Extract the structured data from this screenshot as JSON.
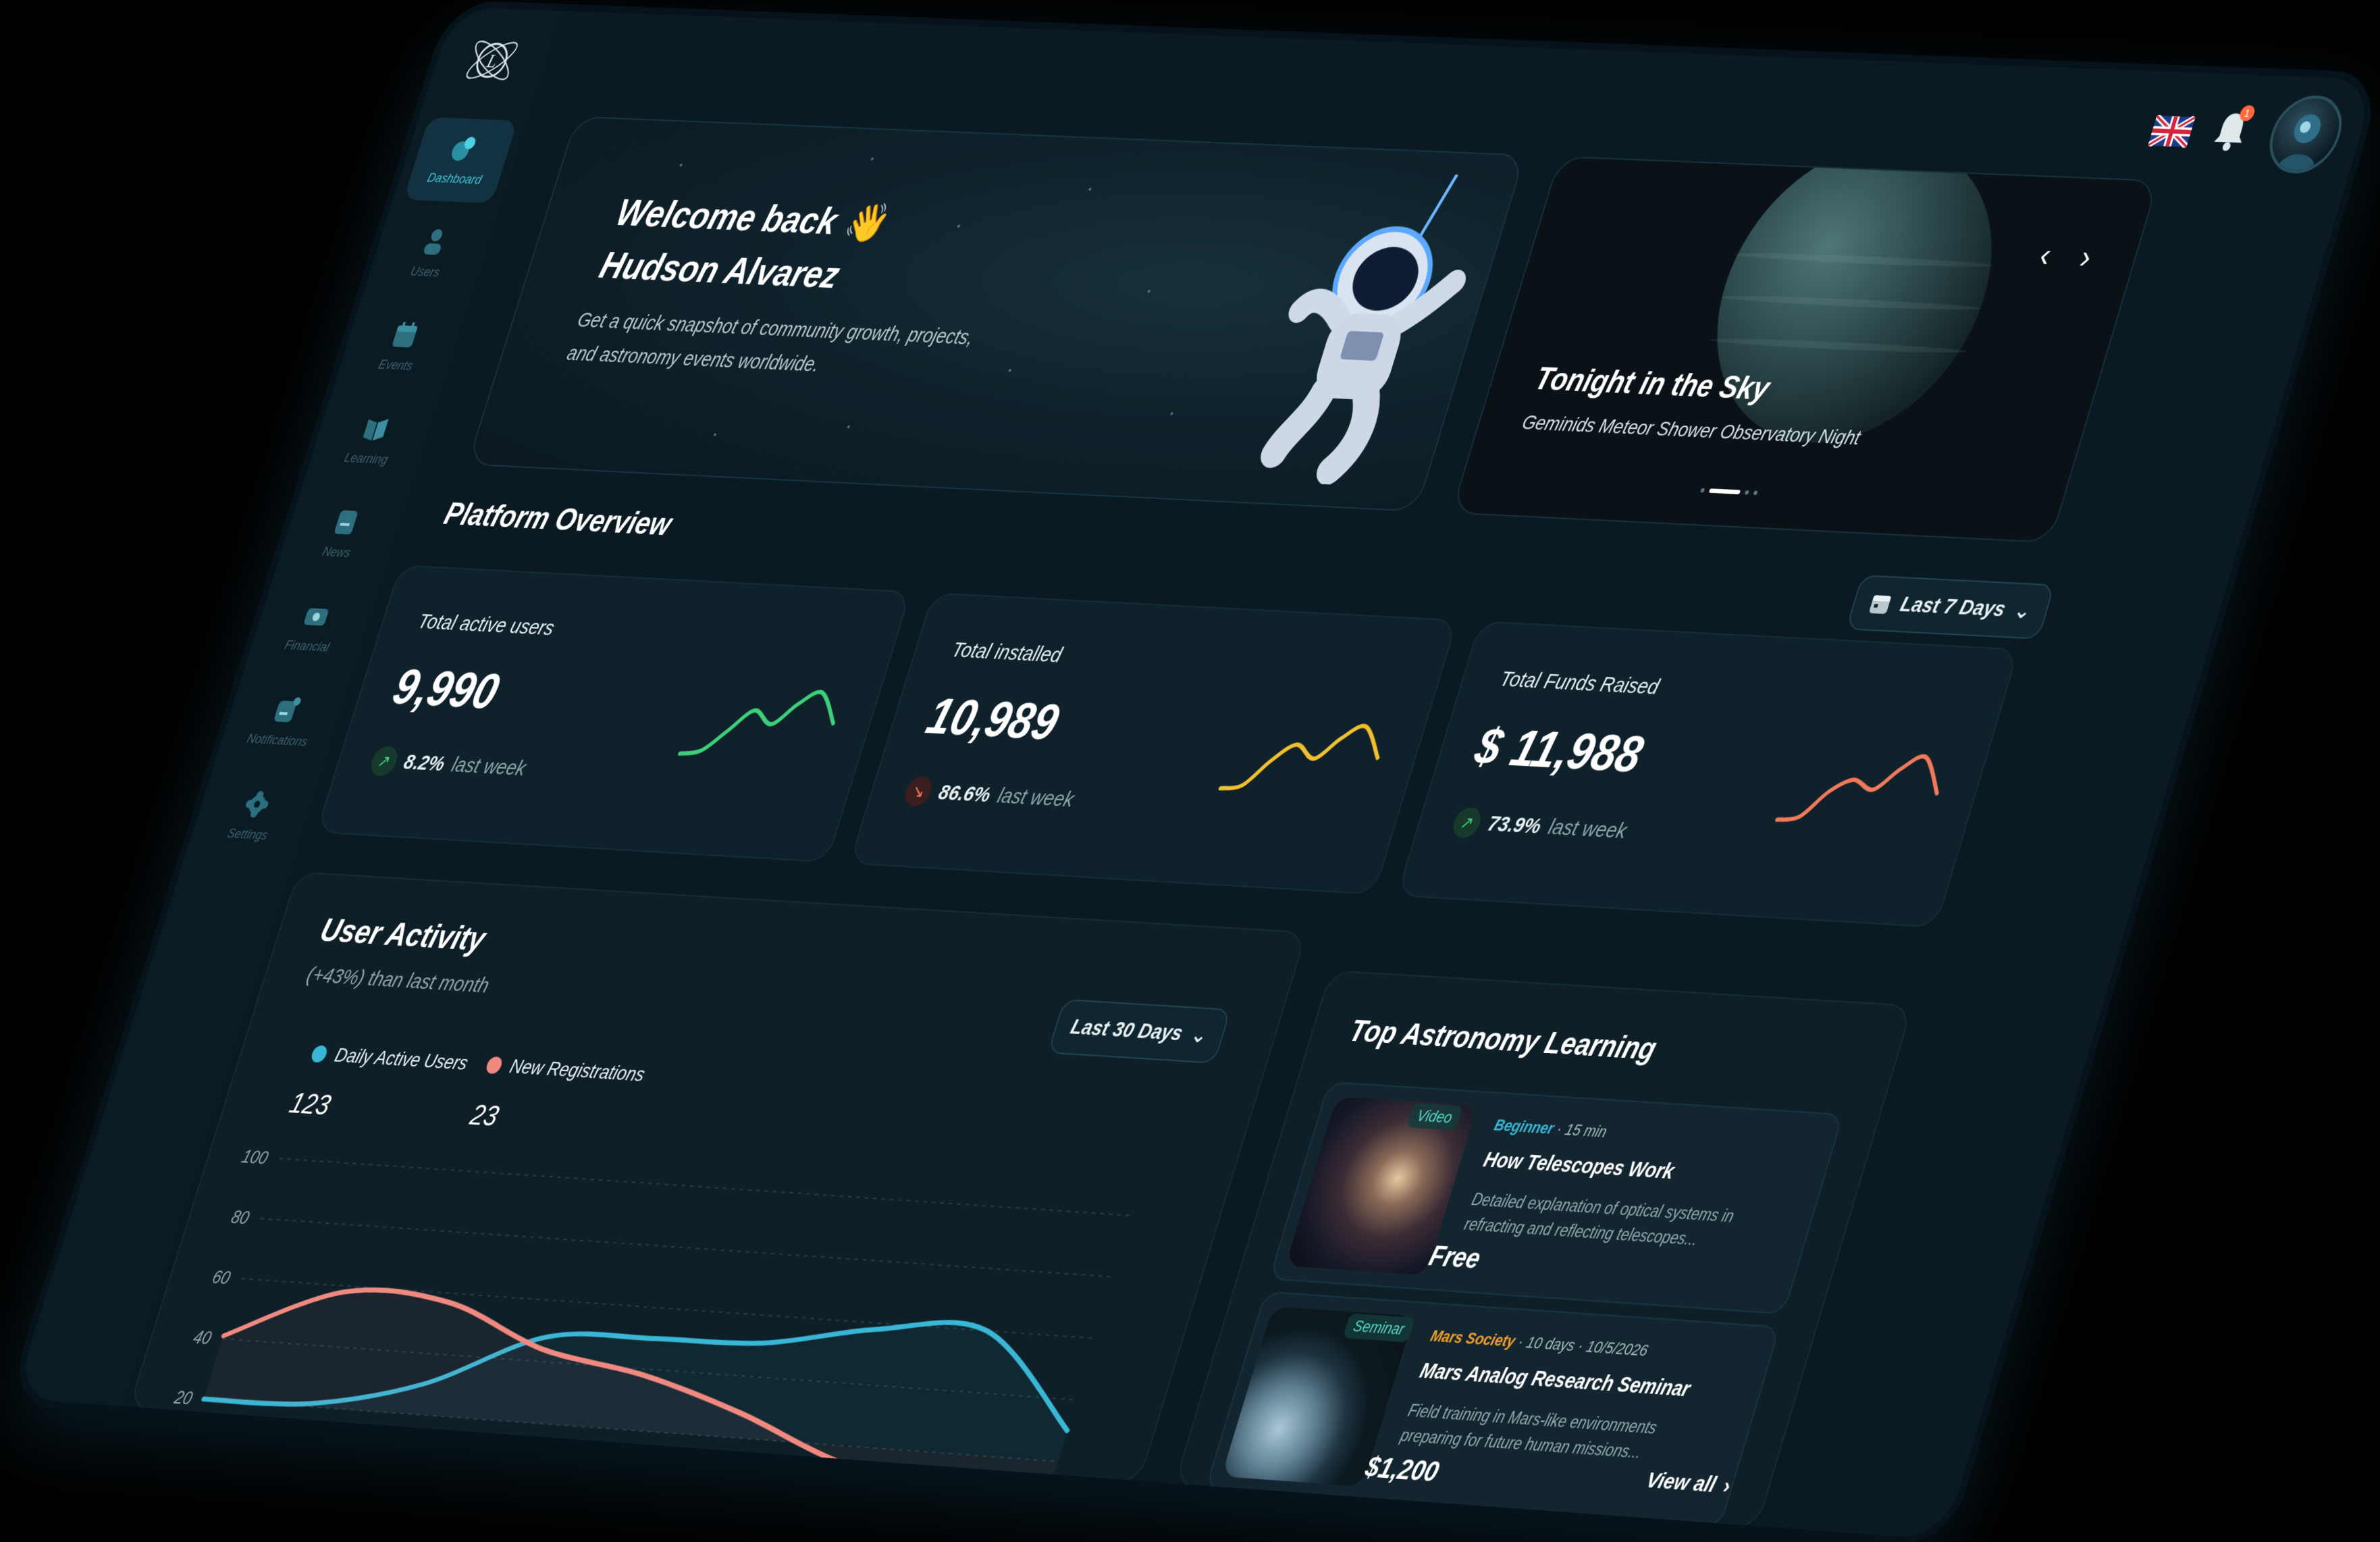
{
  "sidebar": {
    "items": [
      {
        "label": "Dashboard",
        "icon": "dashboard-icon",
        "active": true
      },
      {
        "label": "Users",
        "icon": "users-icon"
      },
      {
        "label": "Events",
        "icon": "calendar-icon"
      },
      {
        "label": "Learning",
        "icon": "book-icon"
      },
      {
        "label": "News",
        "icon": "news-icon"
      },
      {
        "label": "Financial",
        "icon": "wallet-icon"
      },
      {
        "label": "Notifications",
        "icon": "notification-icon"
      },
      {
        "label": "Settings",
        "icon": "gear-icon"
      }
    ]
  },
  "header": {
    "notifications_count": "1",
    "language_flag": "uk-flag-icon"
  },
  "hero": {
    "greeting": "Welcome back 👋",
    "name": "Hudson Alvarez",
    "subtitle": "Get a quick snapshot of community growth, projects, and astronomy events worldwide."
  },
  "sky": {
    "title": "Tonight in the Sky",
    "event": "Geminids Meteor Shower Observatory Night",
    "prev": "‹",
    "next": "›"
  },
  "overview": {
    "title": "Platform Overview",
    "range": "Last 7 Days",
    "stats": [
      {
        "label": "Total active users",
        "value": "9,990",
        "change": "8.2%",
        "note": "last week",
        "trend": "up",
        "color": "#3ecf7a",
        "spark": [
          0.15,
          0.2,
          0.45,
          0.7,
          0.55,
          0.8,
          0.95,
          0.6
        ]
      },
      {
        "label": "Total installed",
        "value": "10,989",
        "change": "86.6%",
        "note": "last week",
        "trend": "down",
        "color": "#f0c030",
        "spark": [
          0.1,
          0.15,
          0.45,
          0.65,
          0.5,
          0.75,
          0.9,
          0.55
        ]
      },
      {
        "label": "Total Funds Raised",
        "value": "$ 11,988",
        "change": "73.9%",
        "note": "last week",
        "trend": "up",
        "color": "#f07a5a",
        "spark": [
          0.1,
          0.15,
          0.45,
          0.6,
          0.5,
          0.75,
          0.9,
          0.5
        ]
      }
    ]
  },
  "activity": {
    "title": "User Activity",
    "subtitle": "(+43%) than last month",
    "range": "Last 30 Days",
    "legend": [
      {
        "name": "Daily Active Users",
        "value": "123",
        "color": "#3ab7d6"
      },
      {
        "name": "New Registrations",
        "value": "23",
        "color": "#f08a80"
      }
    ]
  },
  "chart_data": {
    "type": "line",
    "title": "User Activity",
    "yticks": [
      "100",
      "80",
      "60",
      "40",
      "20"
    ],
    "ylim": [
      20,
      100
    ],
    "x": [
      0,
      1,
      2,
      3,
      4,
      5,
      6,
      7,
      8
    ],
    "series": [
      {
        "name": "Daily Active Users",
        "values": [
          20,
          21,
          30,
          48,
          50,
          51,
          58,
          60,
          30
        ]
      },
      {
        "name": "New Registrations",
        "values": [
          41,
          58,
          57,
          44,
          38,
          28,
          15,
          8,
          5
        ]
      }
    ]
  },
  "learning": {
    "title": "Top Astronomy Learning",
    "view_all": "View all",
    "courses": [
      {
        "badge": "Video",
        "level": "Beginner",
        "meta": " · 15 min",
        "name": "How Telescopes Work",
        "desc": "Detailed explanation of optical systems in refracting and reflecting telescopes...",
        "price": "Free",
        "level_color": "#3ab7d6"
      },
      {
        "badge": "Seminar",
        "level": "Mars Society",
        "meta": " · 10 days  ·  10/5/2026",
        "name": "Mars Analog Research Seminar",
        "desc": "Field training in Mars-like environments preparing for future human missions...",
        "price": "$1,200",
        "level_color": "#f0a030"
      }
    ]
  }
}
